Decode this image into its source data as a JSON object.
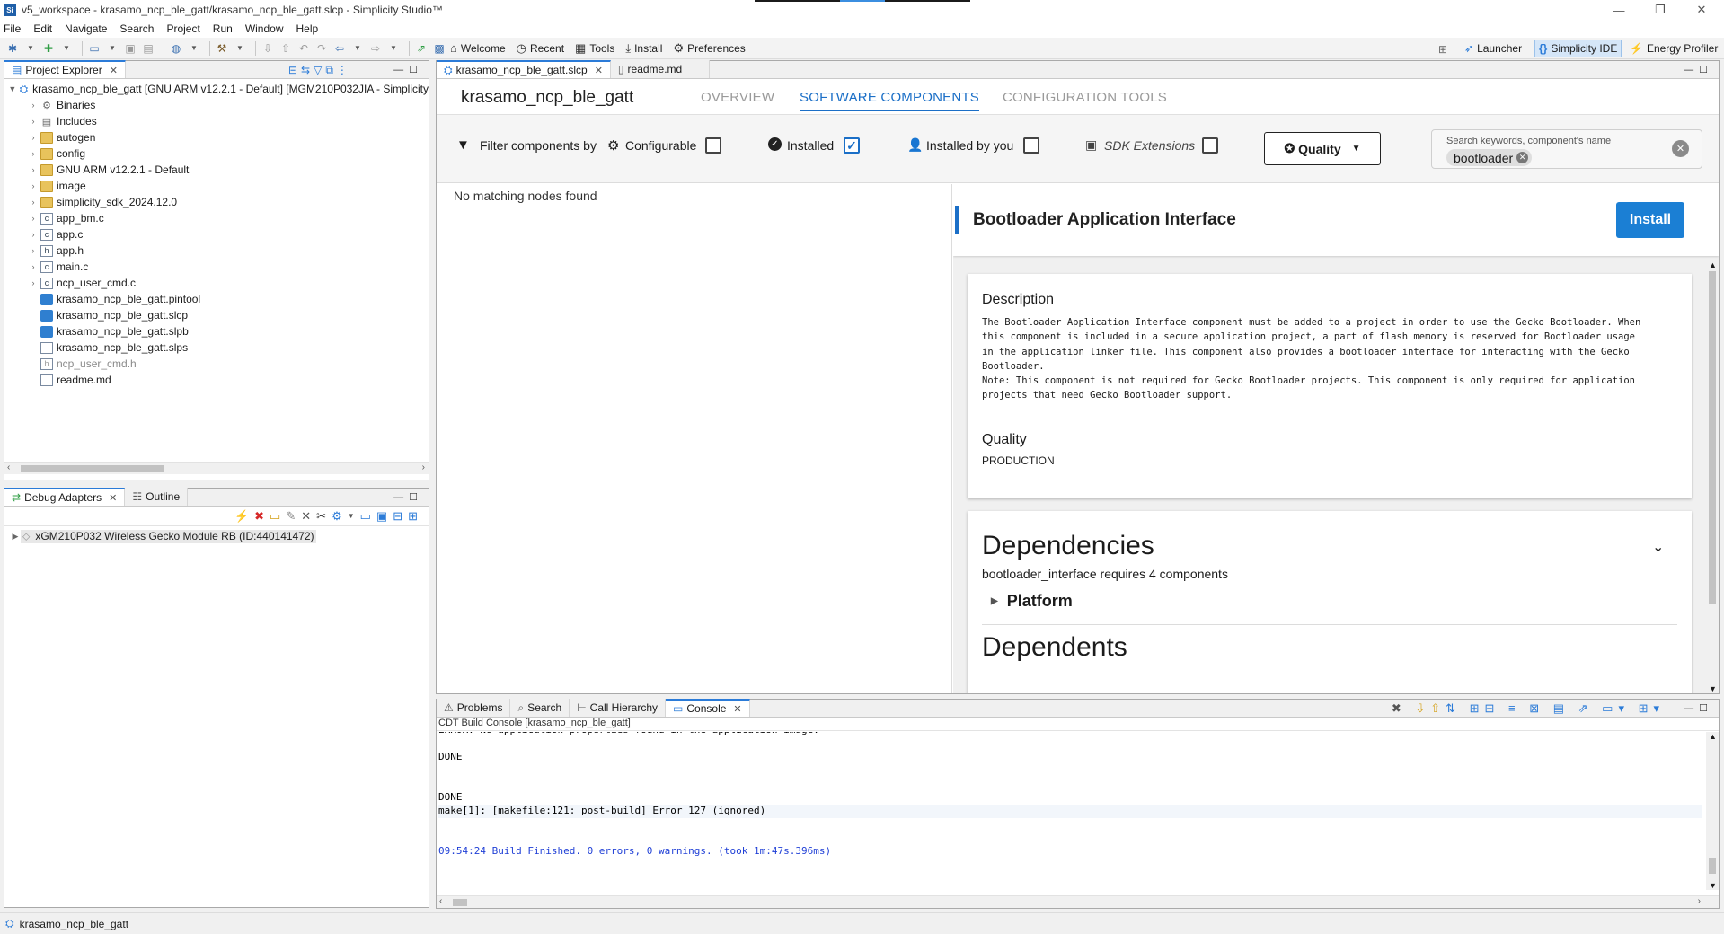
{
  "window": {
    "title": "v5_workspace - krasamo_ncp_ble_gatt/krasamo_ncp_ble_gatt.slcp - Simplicity Studio™",
    "app_icon": "Si",
    "controls": {
      "minimize": "—",
      "restore": "❐",
      "close": "✕"
    }
  },
  "menu": [
    "File",
    "Edit",
    "Navigate",
    "Search",
    "Project",
    "Run",
    "Window",
    "Help"
  ],
  "toolbar": {
    "links": [
      {
        "label": "Welcome",
        "icon": "home-icon",
        "glyph": "⌂"
      },
      {
        "label": "Recent",
        "icon": "clock-icon",
        "glyph": "◷"
      },
      {
        "label": "Tools",
        "icon": "grid-icon",
        "glyph": "▦"
      },
      {
        "label": "Install",
        "icon": "install-icon",
        "glyph": "⤓"
      },
      {
        "label": "Preferences",
        "icon": "gear-icon",
        "glyph": "⚙"
      }
    ],
    "perspectives": [
      {
        "label": "Launcher",
        "icon": "rocket-icon",
        "glyph": "➶"
      },
      {
        "label": "Simplicity IDE",
        "icon": "braces-icon",
        "glyph": "{}"
      },
      {
        "label": "Energy Profiler",
        "icon": "pulse-icon",
        "glyph": "⚡"
      }
    ]
  },
  "project_explorer": {
    "tab_label": "Project Explorer",
    "root": "krasamo_ncp_ble_gatt [GNU ARM v12.2.1 - Default] [MGM210P032JIA - Simplicity",
    "items": [
      {
        "label": "Binaries",
        "kind": "binaries",
        "expandable": true
      },
      {
        "label": "Includes",
        "kind": "includes",
        "expandable": true
      },
      {
        "label": "autogen",
        "kind": "folder",
        "expandable": true
      },
      {
        "label": "config",
        "kind": "folder",
        "expandable": true
      },
      {
        "label": "GNU ARM v12.2.1 - Default",
        "kind": "folder",
        "expandable": true
      },
      {
        "label": "image",
        "kind": "folder",
        "expandable": true
      },
      {
        "label": "simplicity_sdk_2024.12.0",
        "kind": "folder",
        "expandable": true
      },
      {
        "label": "app_bm.c",
        "kind": "c",
        "expandable": true
      },
      {
        "label": "app.c",
        "kind": "c",
        "expandable": true
      },
      {
        "label": "app.h",
        "kind": "h",
        "expandable": true
      },
      {
        "label": "main.c",
        "kind": "c",
        "expandable": true
      },
      {
        "label": "ncp_user_cmd.c",
        "kind": "c",
        "expandable": true
      },
      {
        "label": "krasamo_ncp_ble_gatt.pintool",
        "kind": "blue",
        "expandable": false
      },
      {
        "label": "krasamo_ncp_ble_gatt.slcp",
        "kind": "blue",
        "expandable": false
      },
      {
        "label": "krasamo_ncp_ble_gatt.slpb",
        "kind": "blue",
        "expandable": false
      },
      {
        "label": "krasamo_ncp_ble_gatt.slps",
        "kind": "file",
        "expandable": false
      },
      {
        "label": "ncp_user_cmd.h",
        "kind": "h-grey",
        "expandable": false
      },
      {
        "label": "readme.md",
        "kind": "file",
        "expandable": false
      }
    ]
  },
  "debug_adapters": {
    "tab_label": "Debug Adapters",
    "outline_tab": "Outline",
    "device": "xGM210P032 Wireless Gecko Module RB (ID:440141472)"
  },
  "editor": {
    "tabs": [
      {
        "label": "krasamo_ncp_ble_gatt.slcp",
        "active": true
      },
      {
        "label": "readme.md",
        "active": false
      }
    ],
    "project_name": "krasamo_ncp_ble_gatt",
    "nav": [
      "OVERVIEW",
      "SOFTWARE COMPONENTS",
      "CONFIGURATION TOOLS"
    ],
    "filter": {
      "label": "Filter components by",
      "configurable": "Configurable",
      "installed": "Installed",
      "installed_by_you": "Installed by you",
      "sdk_extensions": "SDK Extensions",
      "quality_button": "Quality",
      "search_label": "Search keywords, component's name",
      "search_chip": "bootloader"
    },
    "tree_empty": "No matching nodes found",
    "component": {
      "title": "Bootloader Application Interface",
      "install_button": "Install",
      "description_heading": "Description",
      "description_lines": [
        "The Bootloader Application Interface component must be added to a project in order to use the Gecko Bootloader. When",
        "this component is included in a secure application project, a part of flash memory is reserved for Bootloader usage",
        "in the application linker file. This component also provides a bootloader interface for interacting with the Gecko",
        "Bootloader.",
        "Note: This component is not required for Gecko Bootloader projects. This component is only required for application",
        "projects that need Gecko Bootloader support."
      ],
      "quality_heading": "Quality",
      "quality_value": "PRODUCTION",
      "dependencies_heading": "Dependencies",
      "dependencies_sub": "bootloader_interface requires 4 components",
      "platform_label": "Platform",
      "dependents_heading": "Dependents"
    }
  },
  "console": {
    "tabs": [
      "Problems",
      "Search",
      "Call Hierarchy",
      "Console"
    ],
    "header": "CDT Build Console [krasamo_ncp_ble_gatt]",
    "lines": [
      {
        "text": "ERROR: No application properties found in the application image.",
        "color": "#000000"
      },
      {
        "text": "",
        "color": "#000000"
      },
      {
        "text": "DONE",
        "color": "#000000"
      },
      {
        "text": "",
        "color": "#000000"
      },
      {
        "text": "",
        "color": "#000000"
      },
      {
        "text": "DONE",
        "color": "#000000"
      },
      {
        "text": "make[1]: [makefile:121: post-build] Error 127 (ignored)",
        "color": "#000000"
      },
      {
        "text": "",
        "color": "#000000"
      },
      {
        "text": "",
        "color": "#000000"
      },
      {
        "text": "09:54:24 Build Finished. 0 errors, 0 warnings. (took 1m:47s.396ms)",
        "color": "#1f3fd6"
      }
    ]
  },
  "status_bar": {
    "project": "krasamo_ncp_ble_gatt"
  },
  "colors": {
    "accent": "#1b6fc7",
    "install_button": "#1b7fd4",
    "build_finished": "#1f3fd6"
  }
}
